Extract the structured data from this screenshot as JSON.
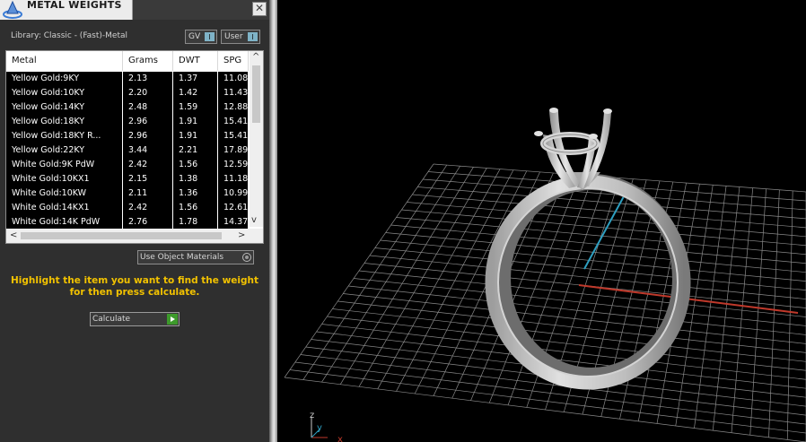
{
  "panel": {
    "title": "METAL WEIGHTS",
    "close_glyph": "✕",
    "library_label": "Library: Classic - (Fast)-Metal",
    "gv_button": "GV",
    "user_button": "User",
    "columns": [
      "Metal",
      "Grams",
      "DWT",
      "SPG"
    ],
    "rows": [
      [
        "Yellow Gold:9KY",
        "2.13",
        "1.37",
        "11.08"
      ],
      [
        "Yellow Gold:10KY",
        "2.20",
        "1.42",
        "11.43"
      ],
      [
        "Yellow Gold:14KY",
        "2.48",
        "1.59",
        "12.88"
      ],
      [
        "Yellow Gold:18KY",
        "2.96",
        "1.91",
        "15.41"
      ],
      [
        "Yellow Gold:18KY R...",
        "2.96",
        "1.91",
        "15.41"
      ],
      [
        "Yellow Gold:22KY",
        "3.44",
        "2.21",
        "17.89"
      ],
      [
        "White Gold:9K PdW",
        "2.42",
        "1.56",
        "12.59"
      ],
      [
        "White Gold:10KX1",
        "2.15",
        "1.38",
        "11.18"
      ],
      [
        "White Gold:10KW",
        "2.11",
        "1.36",
        "10.99"
      ],
      [
        "White Gold:14KX1",
        "2.42",
        "1.56",
        "12.61"
      ],
      [
        "White Gold:14K PdW",
        "2.76",
        "1.78",
        "14.37"
      ]
    ],
    "material_option": "Use Object Materials",
    "hint_text": "Highlight the item you want to find the weight for then press calculate.",
    "calculate_button": "Calculate"
  },
  "viewport": {
    "axis_labels": {
      "z": "z",
      "y": "y",
      "x": "x"
    },
    "colors": {
      "background": "#000000",
      "grid": "#8a8a8a",
      "x_axis": "#c0392b",
      "y_axis": "#2e9fc0",
      "model": "#bdbdbd"
    }
  },
  "colors": {
    "hint": "#f2c200",
    "panel_bg": "#2f2f2f",
    "row_bg": "#000000"
  }
}
